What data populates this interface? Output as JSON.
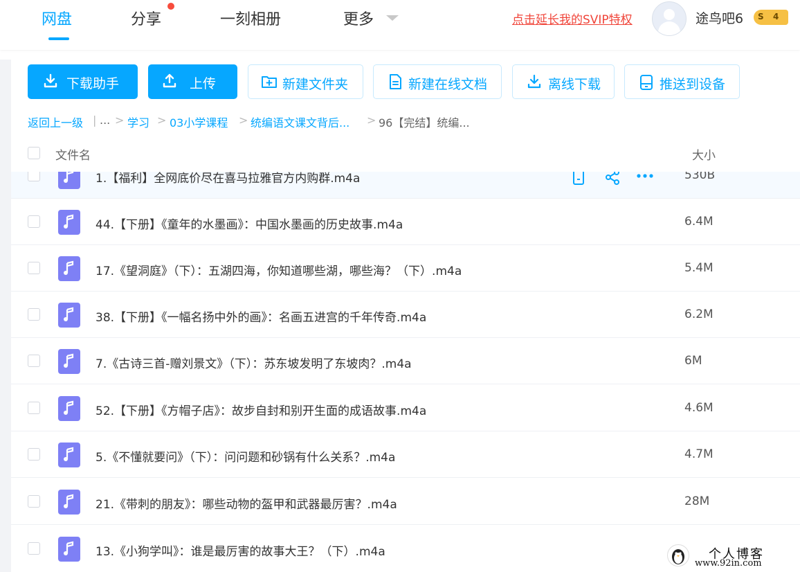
{
  "nav": {
    "tabs": [
      "网盘",
      "分享",
      "一刻相册",
      "更多"
    ],
    "svip_link": "点击延长我的SVIP特权",
    "username": "途鸟吧6",
    "level_badge": {
      "symbol": "S",
      "level": "4"
    }
  },
  "toolbar": {
    "download_helper": "下载助手",
    "upload": "上传",
    "new_folder": "新建文件夹",
    "new_online_doc": "新建在线文档",
    "offline_download": "离线下载",
    "push_to_device": "推送到设备"
  },
  "breadcrumb": {
    "back": "返回上一级",
    "pipe": "|",
    "ellipsis": "...",
    "items": [
      "学习",
      "03小学课程",
      "统编语文课文背后...",
      "96【完结】统编..."
    ]
  },
  "table": {
    "col_name": "文件名",
    "col_size": "大小",
    "rows": [
      {
        "name": "1.【福利】全网底价尽在喜马拉雅官方内购群.m4a",
        "size": "530B"
      },
      {
        "name": "44.【下册】《童年的水墨画》：中国水墨画的历史故事.m4a",
        "size": "6.4M"
      },
      {
        "name": "17.《望洞庭》（下）：五湖四海，你知道哪些湖，哪些海？（下）.m4a",
        "size": "5.4M"
      },
      {
        "name": "38.【下册】《一幅名扬中外的画》：名画五进宫的千年传奇.m4a",
        "size": "6.2M"
      },
      {
        "name": "7.《古诗三首-赠刘景文》（下）：苏东坡发明了东坡肉？.m4a",
        "size": "6M"
      },
      {
        "name": "52.【下册】《方帽子店》：故步自封和别开生面的成语故事.m4a",
        "size": "4.6M"
      },
      {
        "name": "5.《不懂就要问》（下）：问问题和砂锅有什么关系？.m4a",
        "size": "4.7M"
      },
      {
        "name": "21.《带刺的朋友》：哪些动物的盔甲和武器最厉害？.m4a",
        "size": "28M"
      },
      {
        "name": "13.《小狗学叫》：谁是最厉害的故事大王？（下）.m4a",
        "size": ""
      }
    ]
  },
  "watermark": {
    "title": "个人博客",
    "url": "www.92in.com"
  },
  "colors": {
    "accent": "#06a7ff",
    "svip_red": "#f0453a",
    "audio_icon": "#7e80f5",
    "notice_dot": "#f74c3c"
  }
}
